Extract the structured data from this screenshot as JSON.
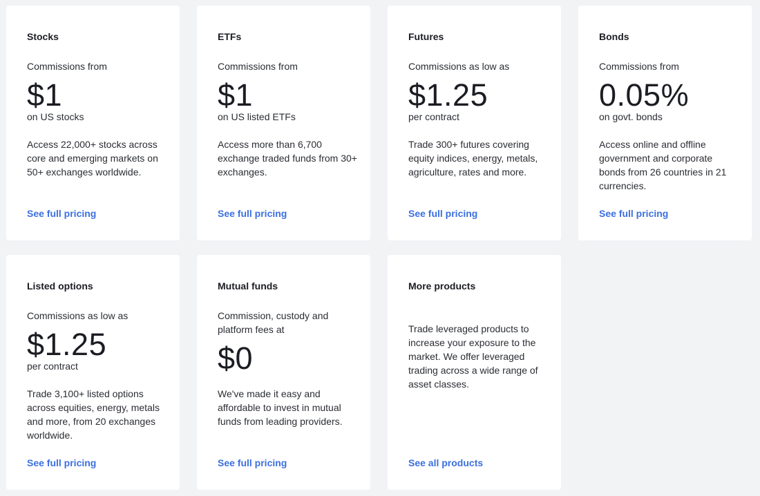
{
  "cards": [
    {
      "title": "Stocks",
      "intro": "Commissions from",
      "price": "$1",
      "unit": "on US stocks",
      "description": "Access 22,000+ stocks across core and emerging markets on 50+ exchanges worldwide.",
      "link": "See full pricing"
    },
    {
      "title": "ETFs",
      "intro": "Commissions from",
      "price": "$1",
      "unit": "on US listed ETFs",
      "description": "Access more than 6,700 exchange traded funds from 30+ exchanges.",
      "link": "See full pricing"
    },
    {
      "title": "Futures",
      "intro": "Commissions as low as",
      "price": "$1.25",
      "unit": "per contract",
      "description": "Trade 300+ futures covering equity indices, energy, metals, agriculture, rates and more.",
      "link": "See full pricing"
    },
    {
      "title": "Bonds",
      "intro": "Commissions from",
      "price": "0.05%",
      "unit": "on govt. bonds",
      "description": "Access online and offline government and corporate bonds from 26 countries in 21 currencies.",
      "link": "See full pricing"
    },
    {
      "title": "Listed options",
      "intro": "Commissions as low as",
      "price": "$1.25",
      "unit": "per contract",
      "description": "Trade 3,100+ listed options across equities, energy, metals and more, from 20 exchanges worldwide.",
      "link": "See full pricing"
    },
    {
      "title": "Mutual funds",
      "intro": "Commission, custody and platform fees at",
      "price": "$0",
      "unit": "",
      "description": "We've made it easy and affordable to invest in mutual funds from leading providers.",
      "link": "See full pricing"
    },
    {
      "title": "More products",
      "intro": "",
      "price": "",
      "unit": "",
      "description": "Trade leveraged products to increase your exposure to the market. We offer leveraged trading across a wide range of asset classes.",
      "link": "See all products"
    }
  ]
}
